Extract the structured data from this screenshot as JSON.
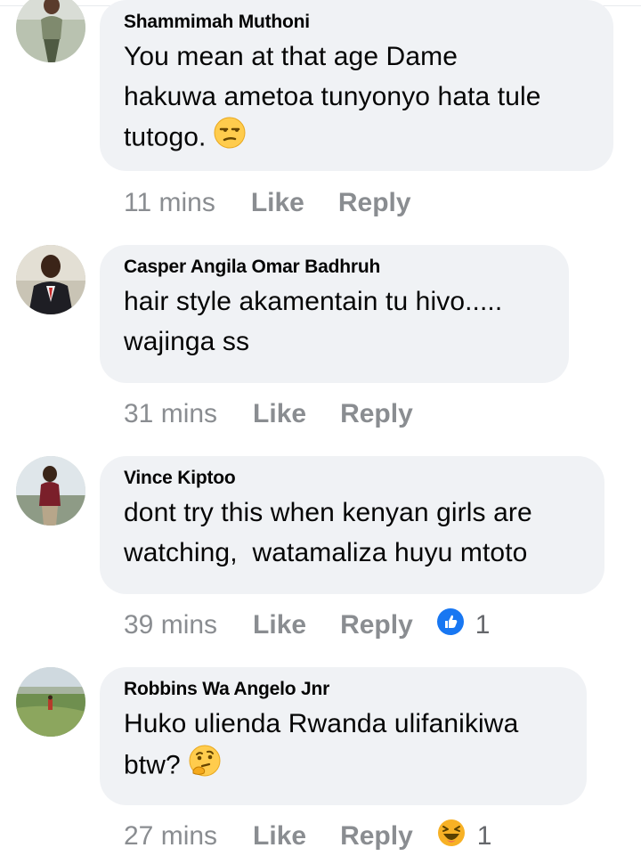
{
  "comments": [
    {
      "name": "Shammimah Muthoni",
      "text": "You mean at that age Dame\nhakuwa ametoa tunyonyo hata tule\ntutogo.",
      "emoji": "unamused-face-emoji",
      "time": "11 mins",
      "like": "Like",
      "reply": "Reply"
    },
    {
      "name": "Casper Angila Omar Badhruh",
      "text": "hair style akamentain tu hivo.....\nwajinga ss",
      "time": "31 mins",
      "like": "Like",
      "reply": "Reply"
    },
    {
      "name": "Vince Kiptoo",
      "text": "dont try this when kenyan girls are\nwatching,  watamaliza huyu mtoto",
      "time": "39 mins",
      "like": "Like",
      "reply": "Reply",
      "reaction": {
        "icon": "like-reaction-icon",
        "count": "1",
        "color": "#1877f2"
      }
    },
    {
      "name": "Robbins Wa Angelo Jnr",
      "text": "Huko ulienda Rwanda ulifanikiwa\nbtw?",
      "emoji": "thinking-face-emoji",
      "time": "27 mins",
      "like": "Like",
      "reply": "Reply",
      "reaction": {
        "icon": "haha-reaction-icon",
        "count": "1",
        "color": "#f7b125"
      }
    }
  ]
}
